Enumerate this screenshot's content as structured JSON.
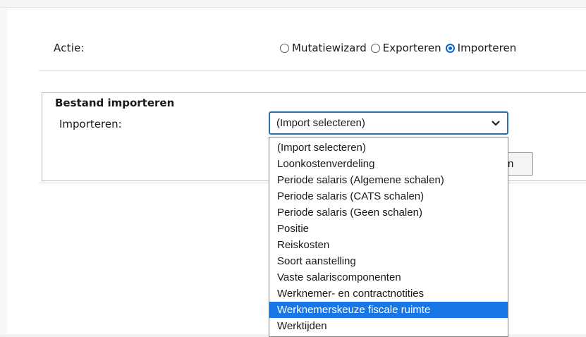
{
  "actie": {
    "label": "Actie:",
    "options": [
      {
        "label": "Mutatiewizard",
        "checked": false
      },
      {
        "label": "Exporteren",
        "checked": false
      },
      {
        "label": "Importeren",
        "checked": true
      }
    ]
  },
  "fieldset": {
    "legend": "Bestand importeren",
    "importeren_label": "Importeren:",
    "selected_value": "(Import selecteren)",
    "obscured_button_text": "n"
  },
  "dropdown": {
    "options": [
      "(Import selecteren)",
      "Loonkostenverdeling",
      "Periode salaris (Algemene schalen)",
      "Periode salaris (CATS schalen)",
      "Periode salaris (Geen schalen)",
      "Positie",
      "Reiskosten",
      "Soort aanstelling",
      "Vaste salariscomponenten",
      "Werknemer- en contractnotities",
      "Werknemerskeuze fiscale ruimte",
      "Werktijden"
    ],
    "highlighted_index": 10
  },
  "colors": {
    "accent": "#0b66d0",
    "highlight": "#1976e7",
    "select_border": "#2d6fb6"
  }
}
